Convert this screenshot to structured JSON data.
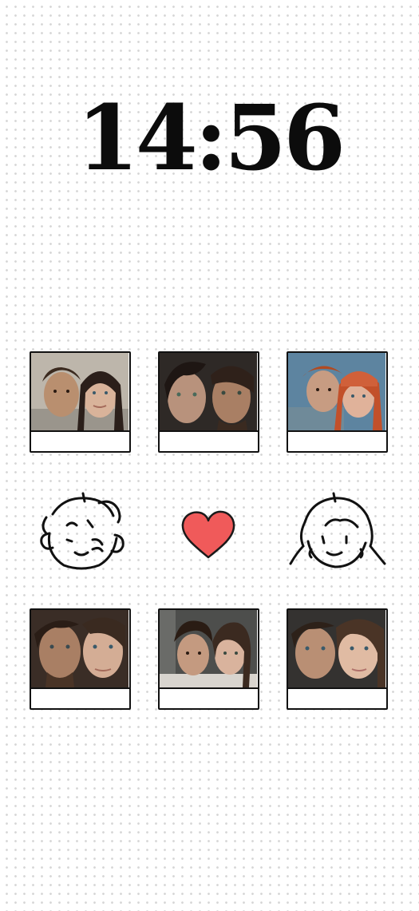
{
  "lockscreen": {
    "time": "14:56"
  },
  "photo_tiles": {
    "top_row": [
      {
        "name": "couple-photo-1",
        "bg": [
          "#c8c2b8",
          "#8a8478"
        ],
        "faces": [
          "#b98f6f",
          "#d9b39a"
        ],
        "hair": [
          "#3b2a1f",
          "#2b1f1a"
        ]
      },
      {
        "name": "couple-photo-2",
        "bg": [
          "#3a3330",
          "#2a2522"
        ],
        "faces": [
          "#b8927c",
          "#a97f64"
        ],
        "hair": [
          "#1e1613",
          "#2f211a"
        ]
      },
      {
        "name": "couple-photo-3",
        "bg": [
          "#6a90a8",
          "#4e6f83"
        ],
        "faces": [
          "#c79c82",
          "#e0b29a"
        ],
        "hair": [
          "#b04a22",
          "#c2502a"
        ]
      }
    ],
    "bottom_row": [
      {
        "name": "couple-photo-4",
        "bg": [
          "#4a3a30",
          "#2e2520"
        ],
        "faces": [
          "#a97f64",
          "#d4ad95"
        ],
        "hair": [
          "#2a1d16",
          "#3a2a20"
        ]
      },
      {
        "name": "couple-photo-5",
        "bg": [
          "#5b5c5a",
          "#3d3d3b"
        ],
        "faces": [
          "#c49a80",
          "#d9b39d"
        ],
        "hair": [
          "#2a1c14",
          "#3b2a20"
        ]
      },
      {
        "name": "couple-photo-6",
        "bg": [
          "#3c3a38",
          "#2a2826"
        ],
        "faces": [
          "#b98f74",
          "#e0bba3"
        ],
        "hair": [
          "#2d2119",
          "#4a3426"
        ]
      }
    ]
  },
  "doodles": {
    "left": "boy-face-icon",
    "center": "heart-icon",
    "right": "girl-face-icon",
    "heart_color": "#f05a5a"
  }
}
